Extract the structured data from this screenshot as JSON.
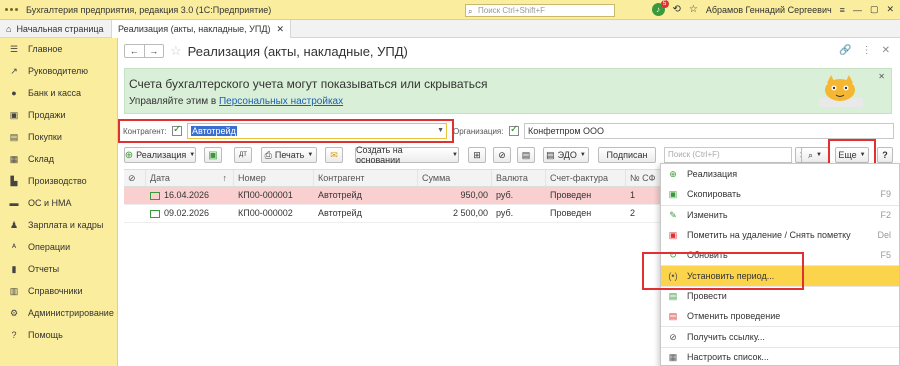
{
  "titlebar": {
    "title": "Бухгалтерия предприятия, редакция 3.0  (1С:Предприятие)",
    "search_placeholder": "Поиск Ctrl+Shift+F",
    "notifications_count": "5",
    "user": "Абрамов Геннадий Сергеевич"
  },
  "tabs": {
    "home": "Начальная страница",
    "active": "Реализация (акты, накладные, УПД)"
  },
  "sidebar": {
    "items": [
      {
        "label": "Главное",
        "icon": "menu-icon"
      },
      {
        "label": "Руководителю",
        "icon": "trend-icon"
      },
      {
        "label": "Банк и касса",
        "icon": "coin-icon"
      },
      {
        "label": "Продажи",
        "icon": "cart-icon"
      },
      {
        "label": "Покупки",
        "icon": "basket-icon"
      },
      {
        "label": "Склад",
        "icon": "warehouse-icon"
      },
      {
        "label": "Производство",
        "icon": "factory-icon"
      },
      {
        "label": "ОС и НМА",
        "icon": "truck-icon"
      },
      {
        "label": "Зарплата и кадры",
        "icon": "people-icon"
      },
      {
        "label": "Операции",
        "icon": "operations-icon"
      },
      {
        "label": "Отчеты",
        "icon": "chart-icon"
      },
      {
        "label": "Справочники",
        "icon": "book-icon"
      },
      {
        "label": "Администрирование",
        "icon": "gear-icon"
      },
      {
        "label": "Помощь",
        "icon": "help-icon"
      }
    ]
  },
  "page": {
    "title": "Реализация (акты, накладные, УПД)"
  },
  "banner": {
    "line1": "Счета бухгалтерского учета могут показываться или скрываться",
    "line2_prefix": "Управляйте этим в ",
    "line2_link": "Персональных настройках"
  },
  "filters": {
    "counterparty_label": "Контрагент:",
    "counterparty_value": "Автотрейд",
    "org_label": "Организация:",
    "org_value": "Конфетпром ООО"
  },
  "toolbar": {
    "realization": "Реализация",
    "print": "Печать",
    "create_based": "Создать на основании",
    "edo": "ЭДО",
    "sign": "Подписан",
    "search_placeholder": "Поиск (Ctrl+F)",
    "more": "Еще"
  },
  "table": {
    "columns": [
      "Дата",
      "Номер",
      "Контрагент",
      "Сумма",
      "Валюта",
      "Счет-фактура",
      "№ СФ"
    ],
    "rows": [
      {
        "date": "16.04.2026",
        "number": "КП00-000001",
        "counterparty": "Автотрейд",
        "sum": "950,00",
        "currency": "руб.",
        "invoice": "Проведен",
        "sf": "1"
      },
      {
        "date": "09.02.2026",
        "number": "КП00-000002",
        "counterparty": "Автотрейд",
        "sum": "2 500,00",
        "currency": "руб.",
        "invoice": "Проведен",
        "sf": "2"
      }
    ]
  },
  "menu": {
    "items": [
      {
        "label": "Реализация",
        "key": "",
        "icon": "add-icon"
      },
      {
        "label": "Скопировать",
        "key": "F9",
        "icon": "copy-icon"
      },
      {
        "label": "Изменить",
        "key": "F2",
        "icon": "edit-icon"
      },
      {
        "label": "Пометить на удаление / Снять пометку",
        "key": "Del",
        "icon": "delete-mark-icon"
      },
      {
        "label": "Обновить",
        "key": "F5",
        "icon": "refresh-icon"
      },
      {
        "label": "Установить период...",
        "key": "",
        "icon": "period-icon"
      },
      {
        "label": "Провести",
        "key": "",
        "icon": "post-icon"
      },
      {
        "label": "Отменить проведение",
        "key": "",
        "icon": "unpost-icon"
      },
      {
        "label": "Получить ссылку...",
        "key": "",
        "icon": "link-icon"
      },
      {
        "label": "Настроить список...",
        "key": "",
        "icon": "settings-list-icon"
      }
    ]
  }
}
